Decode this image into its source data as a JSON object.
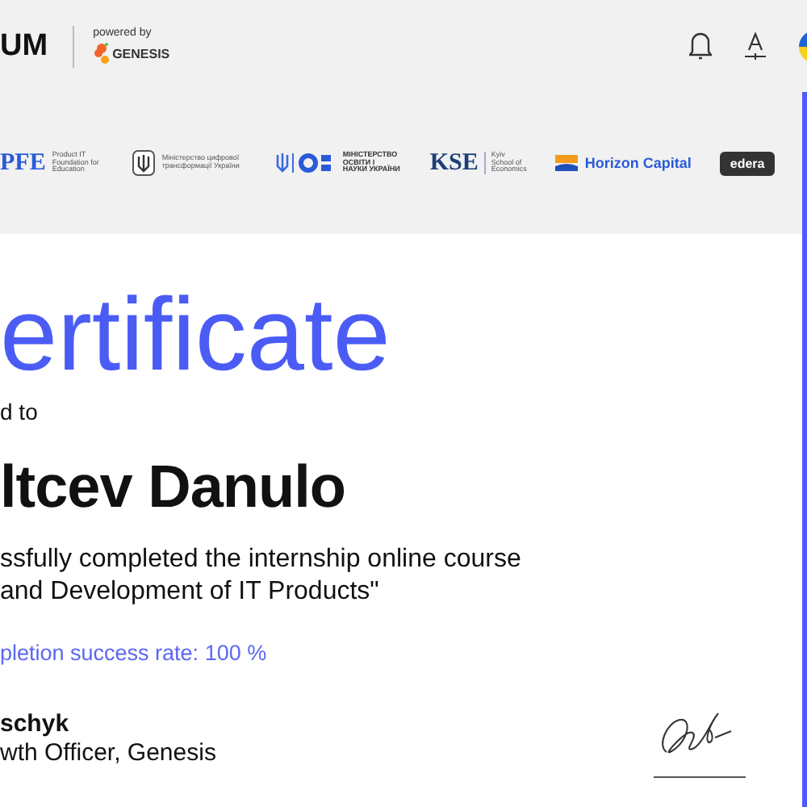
{
  "header": {
    "logo_text": "UM",
    "powered_by": "powered by",
    "brand": "GENESIS"
  },
  "partners": [
    {
      "kind": "pfe",
      "name": "PFE",
      "caption": "Product IT Foundation for Education"
    },
    {
      "kind": "ministry",
      "caption": "Міністерство цифрової трансформації України"
    },
    {
      "kind": "mon",
      "caption": "МІНІСТЕРСТВО ОСВІТИ І НАУКИ УКРАЇНИ"
    },
    {
      "kind": "kse",
      "name": "KSE",
      "caption": "Kyiv School of Economics"
    },
    {
      "kind": "horizon",
      "name": "Horizon Capital"
    },
    {
      "kind": "edera",
      "name": "edera"
    }
  ],
  "certificate": {
    "title": "ertificate",
    "subtitle": "d to",
    "recipient": "ltcev Danulo",
    "course_lines": [
      "ssfully completed the internship online course",
      "and Development of IT Products\""
    ],
    "success_rate": "pletion success rate: 100 %",
    "signer_name": "schyk",
    "signer_role": "wth Officer, Genesis"
  }
}
